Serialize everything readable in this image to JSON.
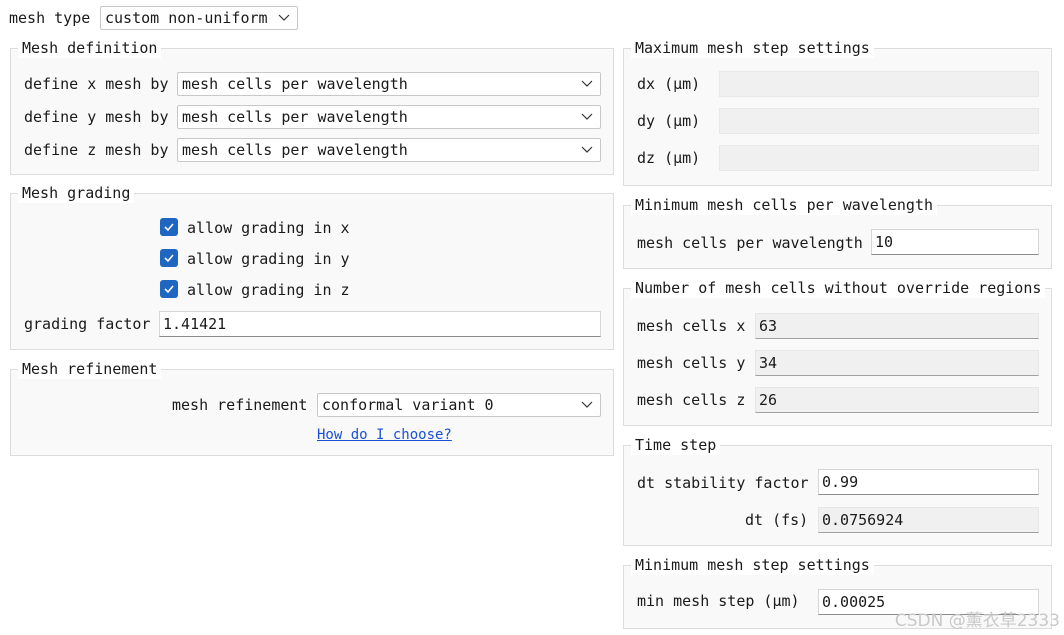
{
  "mesh_type": {
    "label": "mesh type",
    "value": "custom non-uniform"
  },
  "mesh_definition": {
    "title": "Mesh definition",
    "rows": [
      {
        "label": "define x mesh by",
        "value": "mesh cells per wavelength"
      },
      {
        "label": "define y mesh by",
        "value": "mesh cells per wavelength"
      },
      {
        "label": "define z mesh by",
        "value": "mesh cells per wavelength"
      }
    ]
  },
  "mesh_grading": {
    "title": "Mesh grading",
    "checkboxes": [
      {
        "label": "allow grading in x",
        "checked": true
      },
      {
        "label": "allow grading in y",
        "checked": true
      },
      {
        "label": "allow grading in z",
        "checked": true
      }
    ],
    "grading_factor_label": "grading factor",
    "grading_factor_value": "1.41421"
  },
  "mesh_refinement": {
    "title": "Mesh refinement",
    "label": "mesh refinement",
    "value": "conformal variant 0",
    "help_link": "How do I choose?"
  },
  "max_mesh_step": {
    "title": "Maximum mesh step settings",
    "rows": [
      {
        "label": "dx (μm)",
        "value": ""
      },
      {
        "label": "dy (μm)",
        "value": ""
      },
      {
        "label": "dz (μm)",
        "value": ""
      }
    ]
  },
  "min_mesh_cells": {
    "title": "Minimum mesh cells per wavelength",
    "label": "mesh cells per wavelength",
    "value": "10"
  },
  "num_mesh_cells": {
    "title": "Number of mesh cells without override regions",
    "rows": [
      {
        "label": "mesh cells x",
        "value": "63"
      },
      {
        "label": "mesh cells y",
        "value": "34"
      },
      {
        "label": "mesh cells z",
        "value": "26"
      }
    ]
  },
  "time_step": {
    "title": "Time step",
    "stability_label": "dt stability factor",
    "stability_value": "0.99",
    "dt_label": "dt (fs)",
    "dt_value": "0.0756924"
  },
  "min_mesh_step": {
    "title": "Minimum mesh step settings",
    "label": "min mesh step (μm)",
    "value": "0.00025"
  },
  "watermark": "CSDN @薰衣草2333",
  "colors": {
    "checkbox": "#1f66c1",
    "link": "#1a4fd6"
  }
}
